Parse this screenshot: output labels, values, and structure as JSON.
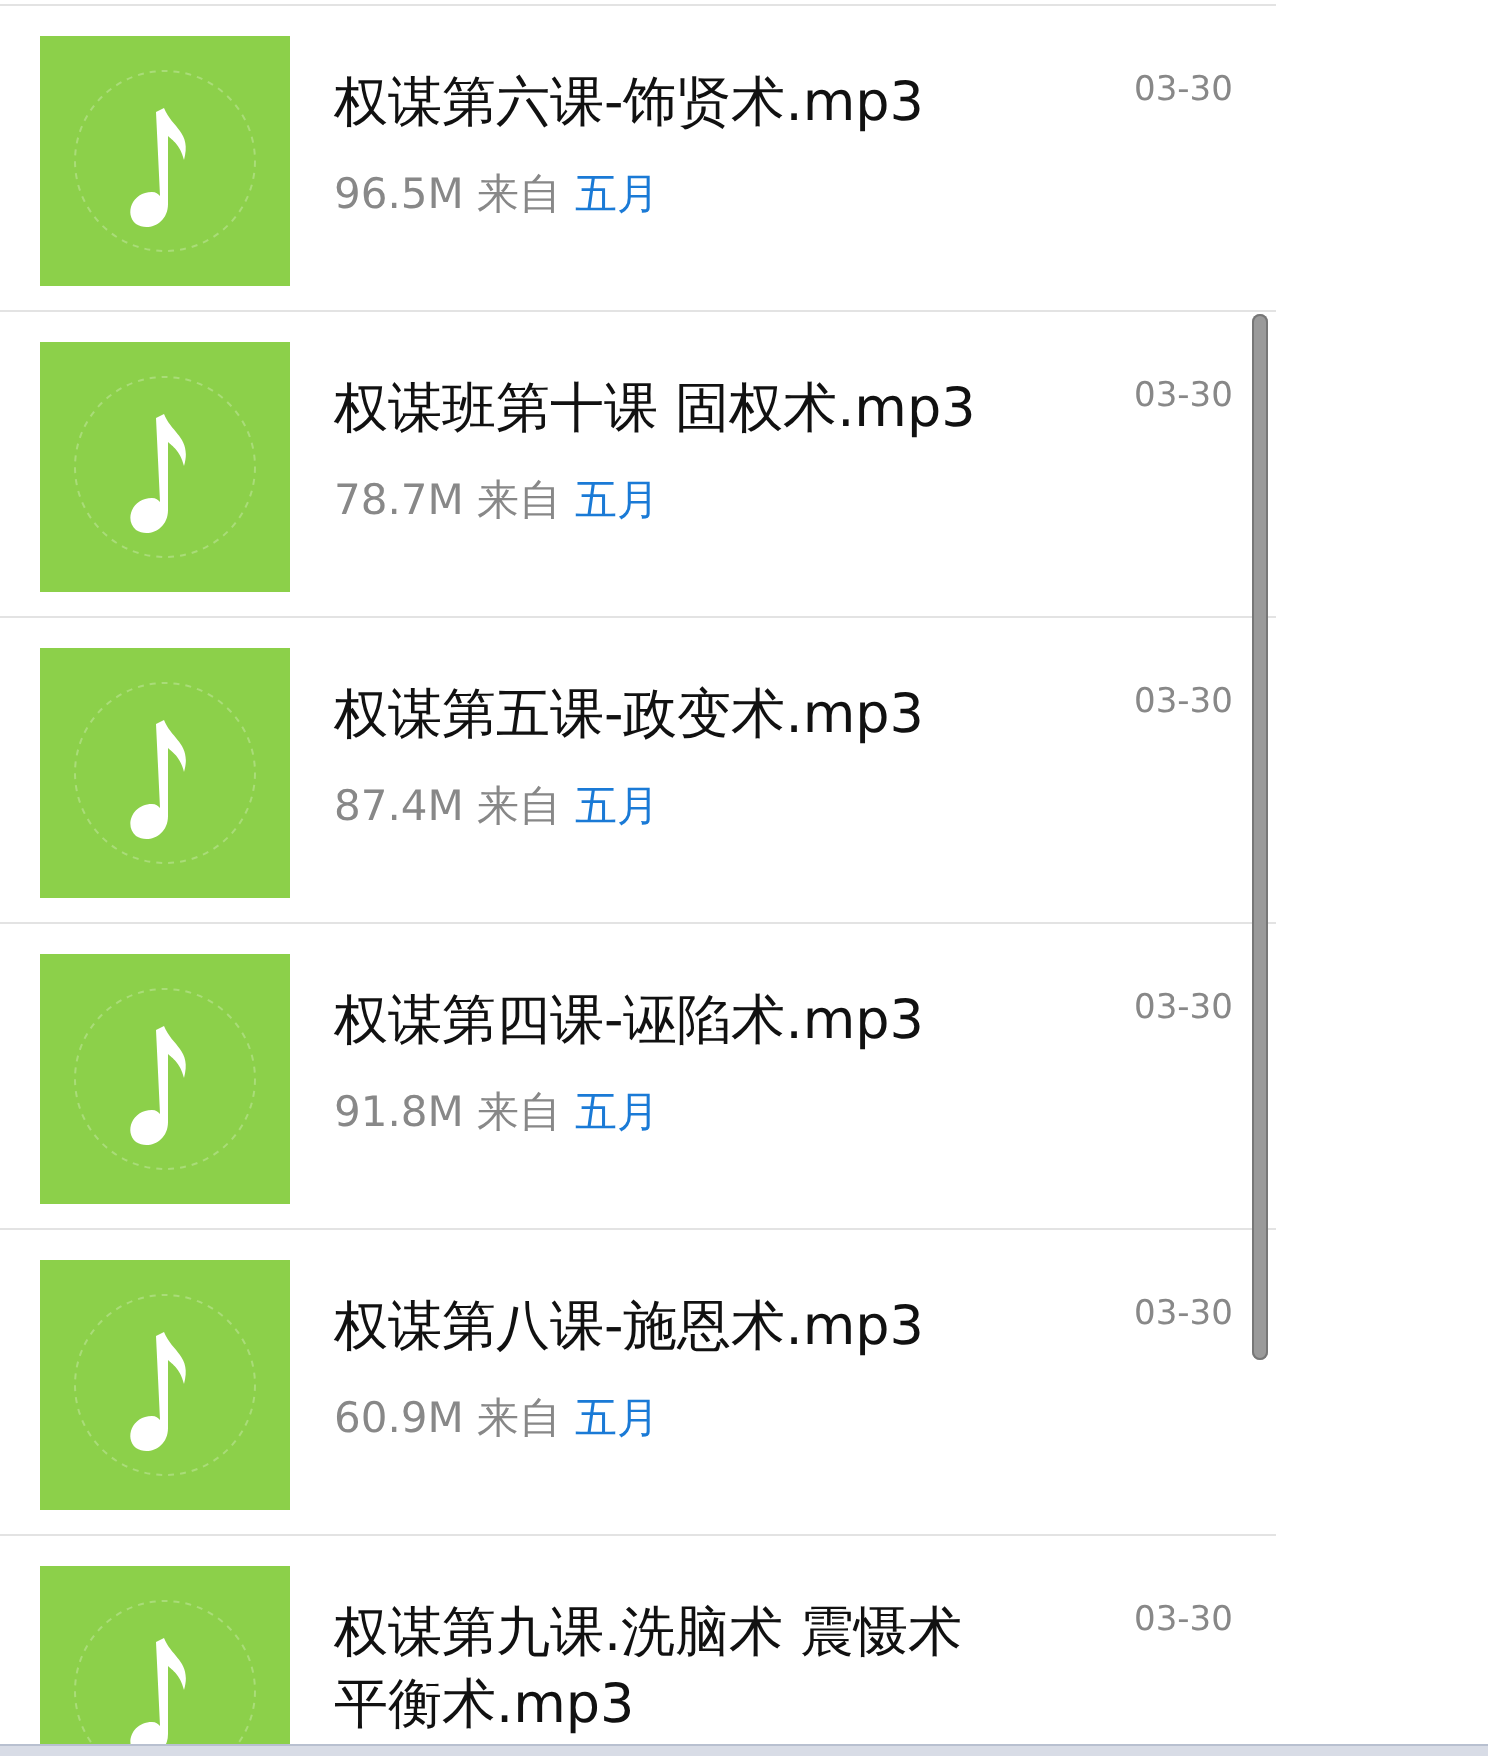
{
  "files": [
    {
      "title": "权谋第六课-饰贤术.mp3",
      "size": "96.5M",
      "from_label": "来自",
      "source": "五月",
      "date": "03-30"
    },
    {
      "title": "权谋班第十课 固权术.mp3",
      "size": "78.7M",
      "from_label": "来自",
      "source": "五月",
      "date": "03-30"
    },
    {
      "title": "权谋第五课-政变术.mp3",
      "size": "87.4M",
      "from_label": "来自",
      "source": "五月",
      "date": "03-30"
    },
    {
      "title": "权谋第四课-诬陷术.mp3",
      "size": "91.8M",
      "from_label": "来自",
      "source": "五月",
      "date": "03-30"
    },
    {
      "title": "权谋第八课-施恩术.mp3",
      "size": "60.9M",
      "from_label": "来自",
      "source": "五月",
      "date": "03-30"
    },
    {
      "title": "权谋第九课.洗脑术 震慑术平衡术.mp3",
      "date": "03-30"
    }
  ]
}
